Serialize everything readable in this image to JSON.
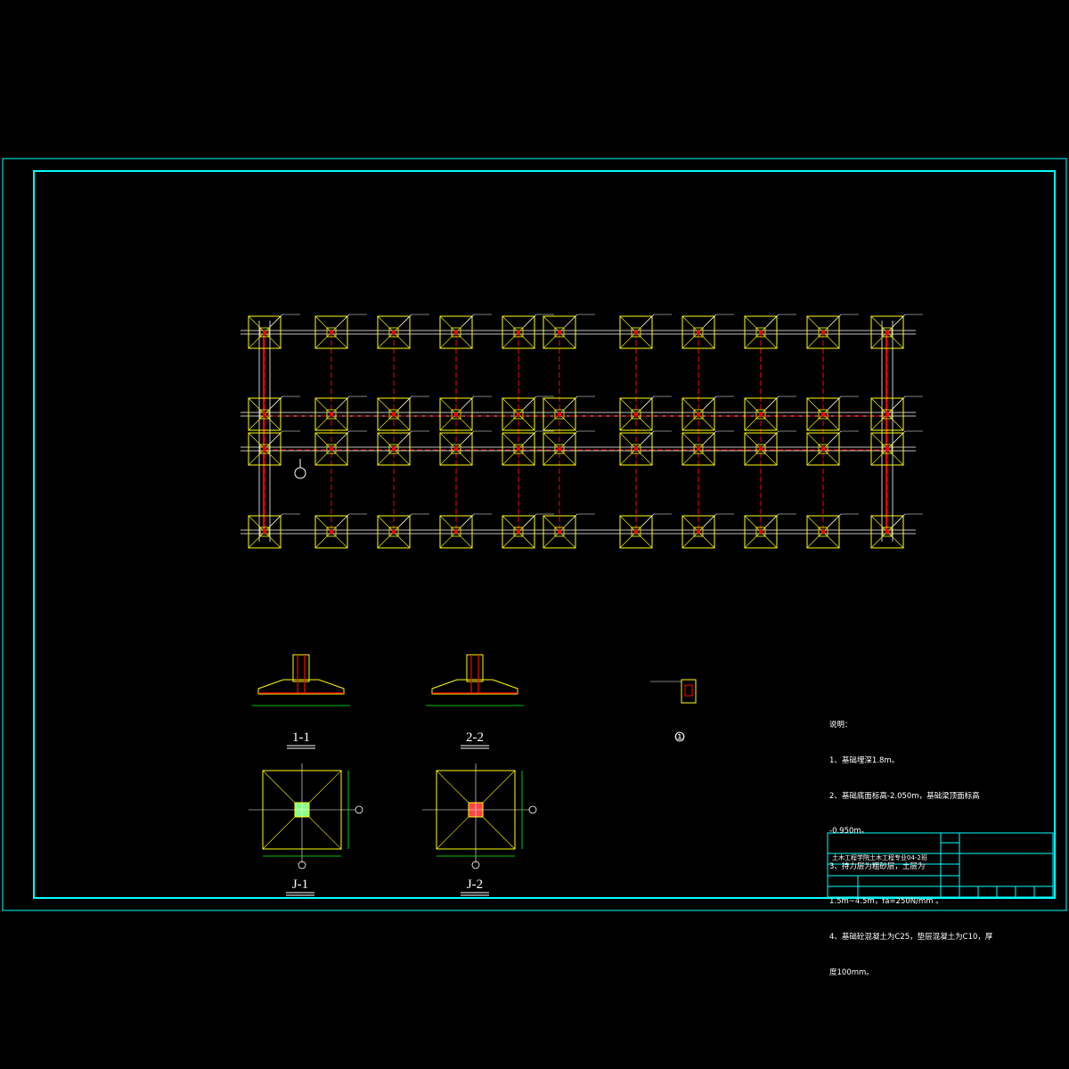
{
  "notes": {
    "heading": "说明：",
    "lines": [
      "1、基础埋深1.8m。",
      "2、基础底面标高-2.050m，基础梁顶面标高",
      "-0.950m。",
      "3、持力层为粗砂层，土层为",
      "1.5m~4.5m，fa=250N/mm 。",
      "4、基础砼混凝土为C25，垫层混凝土为C10，厚",
      "度100mm。"
    ]
  },
  "sections": {
    "s1": "1-1",
    "s2": "2-2",
    "p1": "J-1",
    "p2": "J-2",
    "detail": "①"
  },
  "title_block": {
    "drawing_title": "土木工程学院土木工程专业04-2班"
  },
  "colors": {
    "frame": "#00ffff",
    "footing": "#ffff00",
    "beam": "#ff0000",
    "grid": "#ffffff",
    "dimension": "#00ff00"
  }
}
